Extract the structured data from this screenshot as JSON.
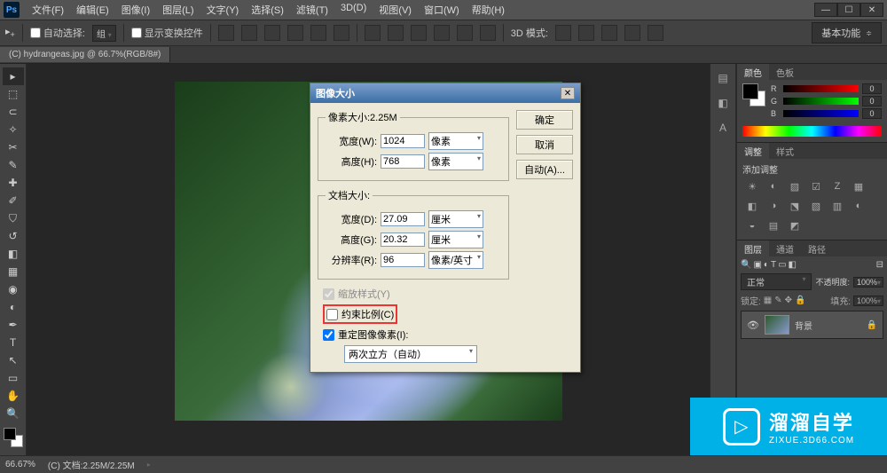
{
  "menubar": [
    "文件(F)",
    "编辑(E)",
    "图像(I)",
    "图层(L)",
    "文字(Y)",
    "选择(S)",
    "滤镜(T)",
    "3D(D)",
    "视图(V)",
    "窗口(W)",
    "帮助(H)"
  ],
  "optbar": {
    "autoSelect": "自动选择:",
    "autoSelectMode": "组",
    "showTransform": "显示变换控件",
    "mode3d": "3D 模式:",
    "workspace": "基本功能"
  },
  "doctab": "(C) hydrangeas.jpg @ 66.7%(RGB/8#)",
  "status": {
    "zoom": "66.67%",
    "doc": "(C) 文档:2.25M/2.25M"
  },
  "panels": {
    "color": {
      "tabs": [
        "颜色",
        "色板"
      ],
      "r": "0",
      "g": "0",
      "b": "0"
    },
    "adjust": {
      "tabs": [
        "调整",
        "样式"
      ],
      "hint": "添加调整"
    },
    "layers": {
      "tabs": [
        "图层",
        "通道",
        "路径"
      ],
      "blend": "正常",
      "opacityLabel": "不透明度:",
      "opacityVal": "100%",
      "lockLabel": "锁定:",
      "fillLabel": "填充:",
      "fillVal": "100%",
      "layerName": "背景"
    }
  },
  "dialog": {
    "title": "图像大小",
    "pixelDimTitle": "像素大小:2.25M",
    "widthLabel": "宽度(W):",
    "widthVal": "1024",
    "widthUnit": "像素",
    "heightLabel": "高度(H):",
    "heightVal": "768",
    "heightUnit": "像素",
    "docDimTitle": "文档大小:",
    "dwidthLabel": "宽度(D):",
    "dwidthVal": "27.09",
    "dwidthUnit": "厘米",
    "dheightLabel": "高度(G):",
    "dheightVal": "20.32",
    "dheightUnit": "厘米",
    "resLabel": "分辨率(R):",
    "resVal": "96",
    "resUnit": "像素/英寸",
    "scaleStyles": "缩放样式(Y)",
    "constrain": "约束比例(C)",
    "resample": "重定图像像素(I):",
    "resampleMode": "两次立方（自动）",
    "ok": "确定",
    "cancel": "取消",
    "auto": "自动(A)..."
  },
  "watermark": {
    "brand": "溜溜自学",
    "url": "ZIXUE.3D66.COM"
  }
}
